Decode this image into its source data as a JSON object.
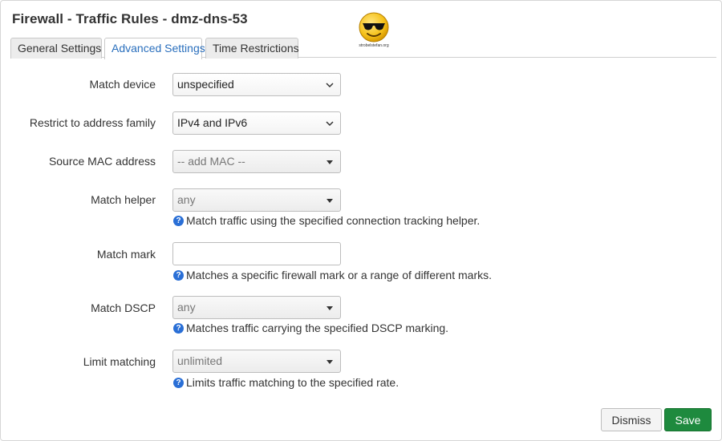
{
  "dialog": {
    "title": "Firewall - Traffic Rules - dmz-dns-53",
    "logo_caption": "strobelstefan.org"
  },
  "tabs": [
    {
      "label": "General Settings",
      "active": false
    },
    {
      "label": "Advanced Settings",
      "active": true
    },
    {
      "label": "Time Restrictions",
      "active": false
    }
  ],
  "fields": {
    "match_device": {
      "label": "Match device",
      "value": "unspecified"
    },
    "address_family": {
      "label": "Restrict to address family",
      "value": "IPv4 and IPv6"
    },
    "source_mac": {
      "label": "Source MAC address",
      "value": "-- add MAC --"
    },
    "match_helper": {
      "label": "Match helper",
      "value": "any",
      "help": "Match traffic using the specified connection tracking helper."
    },
    "match_mark": {
      "label": "Match mark",
      "value": "",
      "help": "Matches a specific firewall mark or a range of different marks."
    },
    "match_dscp": {
      "label": "Match DSCP",
      "value": "any",
      "help": "Matches traffic carrying the specified DSCP marking."
    },
    "limit_matching": {
      "label": "Limit matching",
      "value": "unlimited",
      "help": "Limits traffic matching to the specified rate."
    }
  },
  "help_icon_glyph": "?",
  "buttons": {
    "dismiss": "Dismiss",
    "save": "Save"
  },
  "colors": {
    "accent": "#2a6fbd",
    "save_green": "#1e8a3e",
    "help_blue": "#2a6fd6"
  }
}
